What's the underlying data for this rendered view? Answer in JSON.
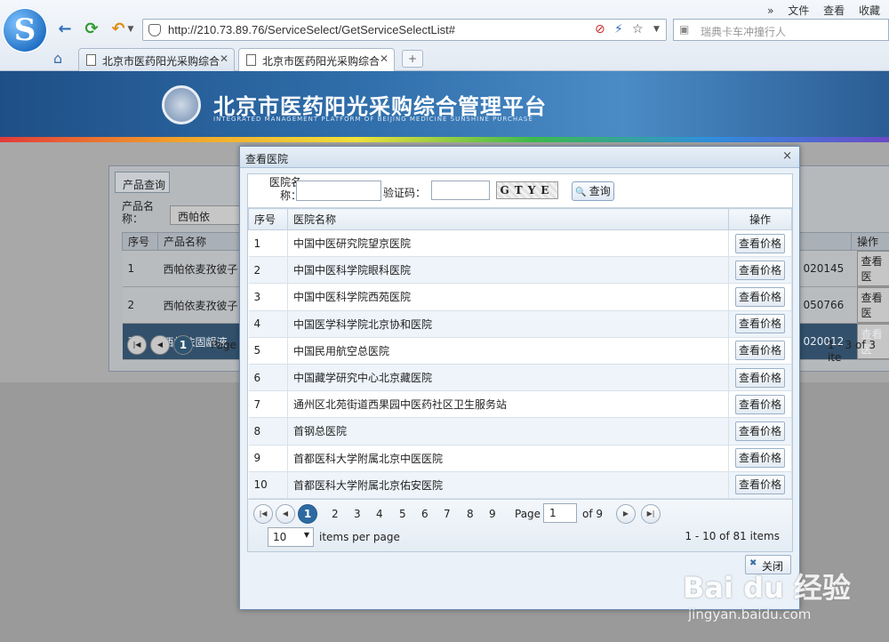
{
  "browser": {
    "logo_letter": "S",
    "url": "http://210.73.89.76/ServiceSelect/GetServiceSelectList#",
    "search_placeholder": "瑞典卡车冲撞行人",
    "menu": [
      "»",
      "文件",
      "查看",
      "收藏"
    ],
    "tabs": [
      {
        "label": "北京市医药阳光采购综合"
      },
      {
        "label": "北京市医药阳光采购综合"
      }
    ],
    "new_tab": "+",
    "icons": [
      "back-icon",
      "refresh-icon",
      "undo-icon",
      "home-icon",
      "shield-icon",
      "star-icon"
    ]
  },
  "banner": {
    "title": "北京市医药阳光采购综合管理平台",
    "subtitle": "INTEGRATED MANAGEMENT PLATFORM OF BEIJING MEDICINE SUNSHINE PURCHASE"
  },
  "background_page": {
    "panel_tab": "产品查询",
    "product_name_label": "产品名称：",
    "product_name_value": "西帕依",
    "columns": [
      "序号",
      "产品名称",
      "",
      "操作"
    ],
    "rows": [
      {
        "no": "1",
        "name": "西帕依麦孜彼子",
        "code": "020145",
        "op": "查看医"
      },
      {
        "no": "2",
        "name": "西帕依麦孜彼子",
        "code": "050766",
        "op": "查看医"
      },
      {
        "no": "3",
        "name": "西帕依固龈液",
        "code": "020012",
        "op": "查看医"
      }
    ],
    "pager_page": "1",
    "pager_page_label": "Page",
    "pager_info": "1 - 3 of 3 ite"
  },
  "dialog": {
    "title": "查看医院",
    "close_glyph": "×",
    "search": {
      "name_label": "医院名称：",
      "name_value": "",
      "code_label": "验证码：",
      "code_value": "",
      "captcha": "GTYE",
      "query_button": "查询"
    },
    "columns": {
      "no": "序号",
      "name": "医院名称",
      "ops": "操作"
    },
    "rows": [
      {
        "no": "1",
        "name": "中国中医研究院望京医院",
        "action": "查看价格"
      },
      {
        "no": "2",
        "name": "中国中医科学院眼科医院",
        "action": "查看价格"
      },
      {
        "no": "3",
        "name": "中国中医科学院西苑医院",
        "action": "查看价格"
      },
      {
        "no": "4",
        "name": "中国医学科学院北京协和医院",
        "action": "查看价格"
      },
      {
        "no": "5",
        "name": "中国民用航空总医院",
        "action": "查看价格"
      },
      {
        "no": "6",
        "name": "中国藏学研究中心北京藏医院",
        "action": "查看价格"
      },
      {
        "no": "7",
        "name": "通州区北苑街道西果园中医药社区卫生服务站",
        "action": "查看价格"
      },
      {
        "no": "8",
        "name": "首钢总医院",
        "action": "查看价格"
      },
      {
        "no": "9",
        "name": "首都医科大学附属北京中医医院",
        "action": "查看价格"
      },
      {
        "no": "10",
        "name": "首都医科大学附属北京佑安医院",
        "action": "查看价格"
      }
    ],
    "pager": {
      "pages": [
        "1",
        "2",
        "3",
        "4",
        "5",
        "6",
        "7",
        "8",
        "9"
      ],
      "current_page": "1",
      "page_label": "Page",
      "of_label": "of 9",
      "page_size": "10",
      "per_page_label": "items per page",
      "info": "1 - 10 of 81 items"
    },
    "close_button": "关闭"
  },
  "watermark": {
    "main": "Bai du 经验",
    "sub": "jingyan.baidu.com"
  }
}
